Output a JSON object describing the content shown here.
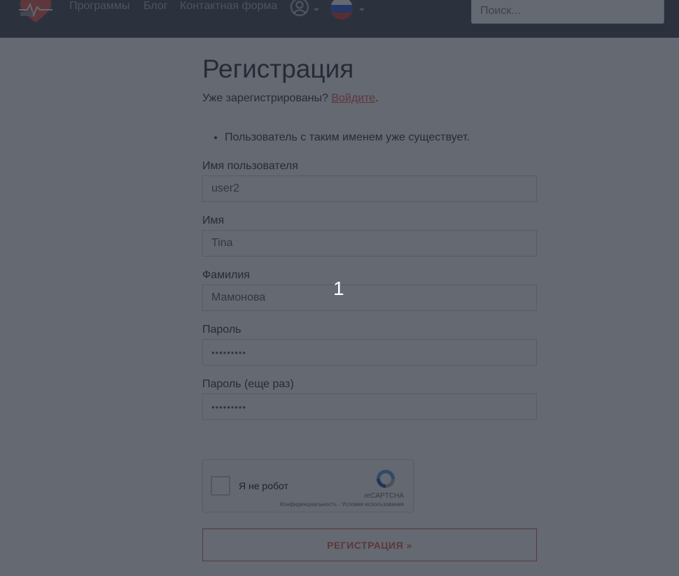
{
  "navbar": {
    "links": [
      "Программы",
      "Блог",
      "Контактная форма"
    ],
    "user_icon": "user-circle-icon",
    "language_icon": "russia-flag-icon",
    "search_placeholder": "Поиск..."
  },
  "page": {
    "title": "Регистрация",
    "already_text": "Уже зарегистрированы?",
    "login_link": "Войдите",
    "period": ".",
    "errors": [
      "Пользователь с таким именем уже существует."
    ]
  },
  "form": {
    "fields": [
      {
        "label": "Имя пользователя",
        "value": "user2"
      },
      {
        "label": "Имя",
        "value": "Tina"
      },
      {
        "label": "Фамилия",
        "value": "Мамонова"
      },
      {
        "label": "Пароль",
        "value": "•••••••••"
      },
      {
        "label": "Пароль (еще раз)",
        "value": "•••••••••"
      }
    ],
    "captcha": {
      "label": "Я не робот",
      "brand": "reCAPTCHA",
      "links": "Конфиденциальность - Условия использования"
    },
    "submit_label": "РЕГИСТРАЦИЯ »"
  },
  "overlay": {
    "number": "1"
  },
  "colors": {
    "navbar": "#343a40",
    "accent": "#e74c3c",
    "overlay": "#282f3c"
  }
}
